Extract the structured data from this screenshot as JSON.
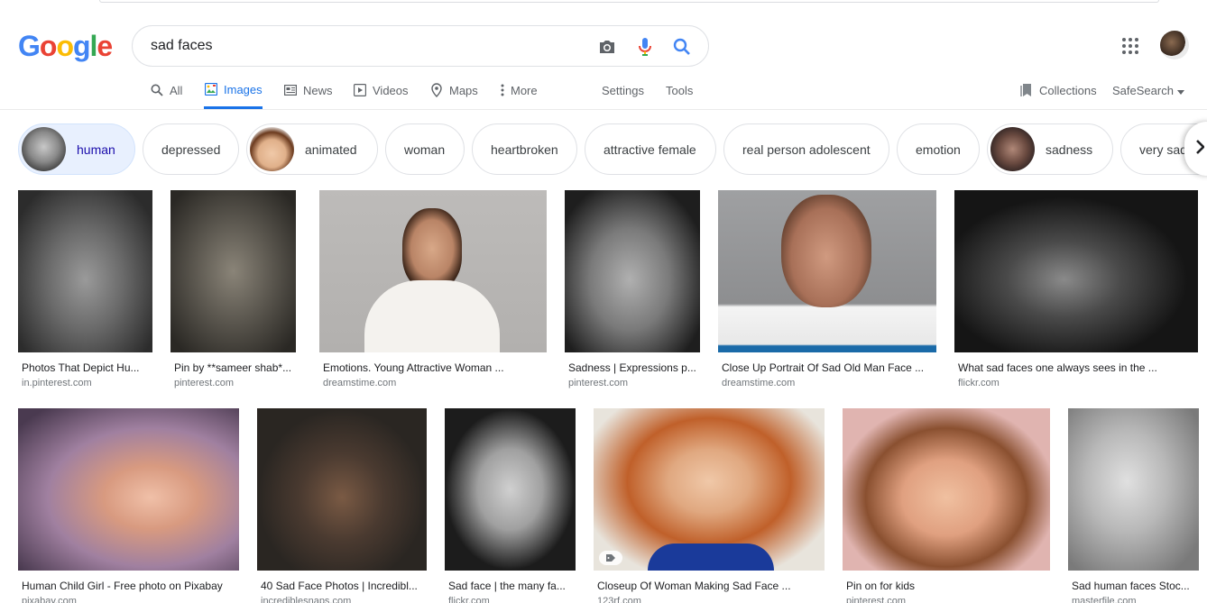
{
  "logo": {
    "text": [
      "G",
      "o",
      "o",
      "g",
      "l",
      "e"
    ],
    "colors": [
      "#4285F4",
      "#EA4335",
      "#FBBC05",
      "#4285F4",
      "#34A853",
      "#EA4335"
    ]
  },
  "search": {
    "query": "sad faces",
    "camera_icon": "camera-icon",
    "mic_icon": "mic-icon",
    "search_icon": "search-icon"
  },
  "header": {
    "apps_icon": "apps-grid-icon",
    "avatar": "account-avatar"
  },
  "tabs": [
    {
      "label": "All",
      "icon": "search-icon",
      "active": false
    },
    {
      "label": "Images",
      "icon": "image-icon",
      "active": true
    },
    {
      "label": "News",
      "icon": "news-icon",
      "active": false
    },
    {
      "label": "Videos",
      "icon": "video-icon",
      "active": false
    },
    {
      "label": "Maps",
      "icon": "map-pin-icon",
      "active": false
    },
    {
      "label": "More",
      "icon": "more-vert-icon",
      "active": false
    },
    {
      "label": "Settings"
    },
    {
      "label": "Tools"
    }
  ],
  "right_tools": {
    "collections": "Collections",
    "safesearch": "SafeSearch"
  },
  "chips": [
    {
      "label": "human",
      "thumb": true,
      "selected": true
    },
    {
      "label": "depressed",
      "thumb": false
    },
    {
      "label": "animated",
      "thumb": true
    },
    {
      "label": "woman",
      "thumb": false
    },
    {
      "label": "heartbroken",
      "thumb": false
    },
    {
      "label": "attractive female",
      "thumb": false
    },
    {
      "label": "real person adolescent",
      "thumb": false
    },
    {
      "label": "emotion",
      "thumb": false
    },
    {
      "label": "sadness",
      "thumb": true
    },
    {
      "label": "very sad",
      "thumb": false
    }
  ],
  "results": [
    {
      "title": "Photos That Depict Hu...",
      "site": "in.pinterest.com"
    },
    {
      "title": "Pin by **sameer shab*...",
      "site": "pinterest.com"
    },
    {
      "title": "Emotions. Young Attractive Woman ...",
      "site": "dreamstime.com"
    },
    {
      "title": "Sadness | Expressions p...",
      "site": "pinterest.com"
    },
    {
      "title": "Close Up Portrait Of Sad Old Man Face ...",
      "site": "dreamstime.com"
    },
    {
      "title": "What sad faces one always sees in the ...",
      "site": "flickr.com"
    },
    {
      "title": "Human Child Girl - Free photo on Pixabay",
      "site": "pixabay.com"
    },
    {
      "title": "40 Sad Face Photos | Incredibl...",
      "site": "incrediblesnaps.com"
    },
    {
      "title": "Sad face | the many fa...",
      "site": "flickr.com"
    },
    {
      "title": "Closeup Of Woman Making Sad Face ...",
      "site": "123rf.com",
      "tag": "tag-icon"
    },
    {
      "title": "Pin on for kids",
      "site": "pinterest.com"
    },
    {
      "title": "Sad human faces Stoc...",
      "site": "masterfile.com"
    }
  ]
}
